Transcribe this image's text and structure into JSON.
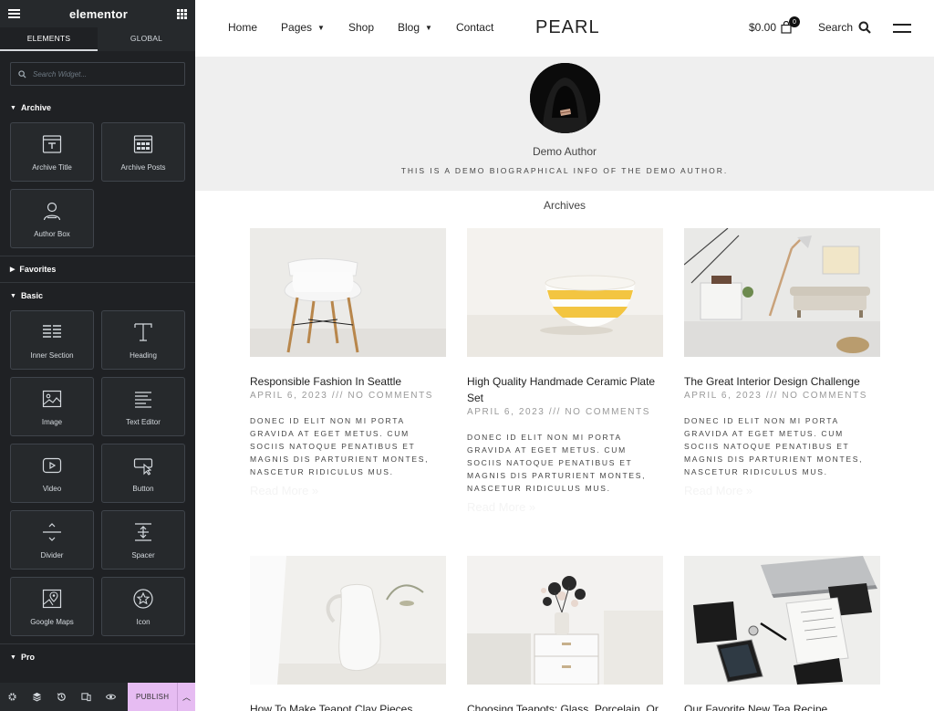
{
  "panel": {
    "logo": "elementor",
    "tabs": [
      "ELEMENTS",
      "GLOBAL"
    ],
    "search_placeholder": "Search Widget...",
    "categories": {
      "archive": "Archive",
      "favorites": "Favorites",
      "basic": "Basic",
      "pro": "Pro"
    },
    "archive_widgets": [
      "Archive Title",
      "Archive Posts",
      "Author Box"
    ],
    "basic_widgets": [
      "Inner Section",
      "Heading",
      "Image",
      "Text Editor",
      "Video",
      "Button",
      "Divider",
      "Spacer",
      "Google Maps",
      "Icon"
    ],
    "publish_label": "PUBLISH"
  },
  "site": {
    "nav": [
      "Home",
      "Pages",
      "Shop",
      "Blog",
      "Contact"
    ],
    "logo": "PEARL",
    "cart_total": "$0.00",
    "cart_count": "0",
    "search_label": "Search",
    "author": {
      "name": "Demo Author",
      "bio": "THIS IS A DEMO BIOGRAPHICAL INFO OF THE DEMO AUTHOR."
    },
    "archives_title": "Archives",
    "posts": [
      {
        "title": "Responsible Fashion In Seattle",
        "meta": "APRIL 6, 2023 /// NO COMMENTS",
        "excerpt": "DONEC ID ELIT NON MI PORTA GRAVIDA AT EGET METUS. CUM SOCIIS NATOQUE PENATIBUS ET MAGNIS DIS PARTURIENT MONTES, NASCETUR RIDICULUS MUS.",
        "more": "Read More »"
      },
      {
        "title": "High Quality Handmade Ceramic Plate Set",
        "meta": "APRIL 6, 2023 /// NO COMMENTS",
        "excerpt": "DONEC ID ELIT NON MI PORTA GRAVIDA AT EGET METUS. CUM SOCIIS NATOQUE PENATIBUS ET MAGNIS DIS PARTURIENT MONTES, NASCETUR RIDICULUS MUS.",
        "more": "Read More »"
      },
      {
        "title": "The Great Interior Design Challenge",
        "meta": "APRIL 6, 2023 /// NO COMMENTS",
        "excerpt": "DONEC ID ELIT NON MI PORTA GRAVIDA AT EGET METUS. CUM SOCIIS NATOQUE PENATIBUS ET MAGNIS DIS PARTURIENT MONTES, NASCETUR RIDICULUS MUS.",
        "more": "Read More »"
      },
      {
        "title": "How To Make Teapot Clay Pieces"
      },
      {
        "title": "Choosing Teapots: Glass, Porcelain, Or"
      },
      {
        "title": "Our Favorite New Tea Recipe"
      }
    ]
  }
}
